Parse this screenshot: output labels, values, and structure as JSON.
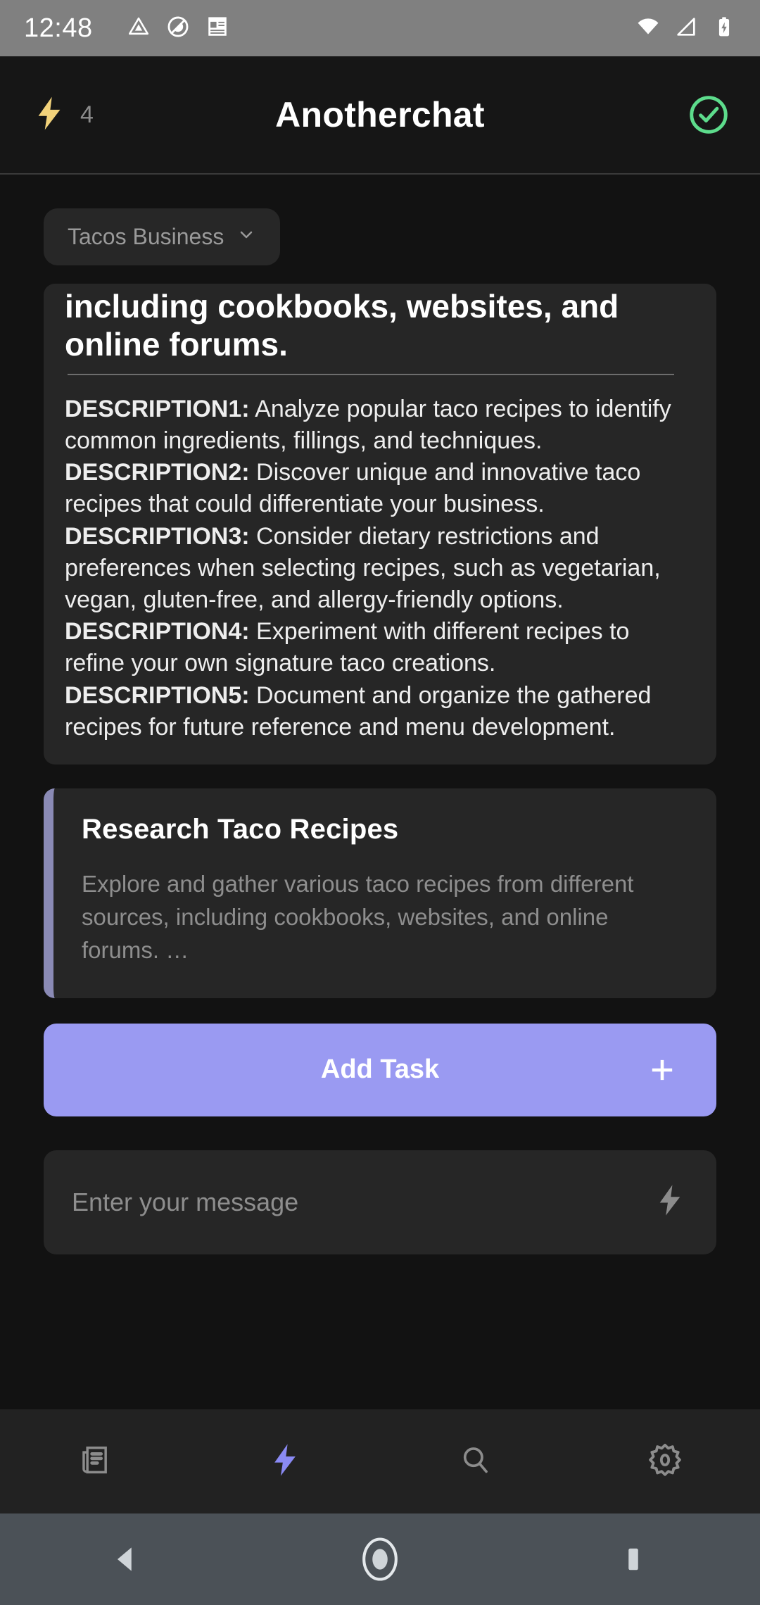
{
  "status_bar": {
    "time": "12:48",
    "left_icons": [
      "drive-triangle-icon",
      "do-not-disturb-icon",
      "notepad-icon"
    ],
    "right_icons": [
      "wifi-icon",
      "cell-signal-icon",
      "battery-charging-icon"
    ],
    "background": "#808080"
  },
  "app_bar": {
    "bolt_icon": "lightning-bolt-icon",
    "bolt_count": "4",
    "title": "Anotherchat",
    "status_icon": "check-circle-icon",
    "status_icon_color": "#5ddc8c"
  },
  "project_selector": {
    "label": "Tacos Business",
    "chevron": "chevron-down-icon"
  },
  "description_card": {
    "title": "including cookbooks, websites, and online forums.",
    "lines": [
      {
        "label": "DESCRIPTION1:",
        "text": " Analyze popular taco recipes to identify common ingredients, fillings, and techniques."
      },
      {
        "label": "DESCRIPTION2:",
        "text": " Discover unique and innovative taco recipes that could differentiate your business."
      },
      {
        "label": "DESCRIPTION3:",
        "text": " Consider dietary restrictions and preferences when selecting recipes, such as vegetarian, vegan, gluten-free, and allergy-friendly options."
      },
      {
        "label": "DESCRIPTION4:",
        "text": " Experiment with different recipes to refine your own signature taco creations."
      },
      {
        "label": "DESCRIPTION5:",
        "text": " Document and organize the gathered recipes for future reference and menu development."
      }
    ]
  },
  "task_card": {
    "title": "Research Taco Recipes",
    "description": "Explore and gather various taco recipes from different sources, including cookbooks, websites, and online forums. …",
    "accent_color": "#8a8ab5"
  },
  "add_task_button": {
    "label": "Add Task",
    "icon": "plus-icon",
    "background": "#9a9af2"
  },
  "message_input": {
    "placeholder": "Enter your message",
    "action_icon": "lightning-bolt-icon"
  },
  "bottom_nav": {
    "items": [
      {
        "name": "news-icon",
        "active": false
      },
      {
        "name": "lightning-bolt-icon",
        "active": true
      },
      {
        "name": "search-icon",
        "active": false
      },
      {
        "name": "gear-icon",
        "active": false
      }
    ],
    "active_color": "#8a8af5",
    "inactive_color": "#8c8c8c"
  },
  "system_nav": {
    "back": "back-triangle-icon",
    "home": "home-circle-icon",
    "recents": "recents-square-icon"
  }
}
